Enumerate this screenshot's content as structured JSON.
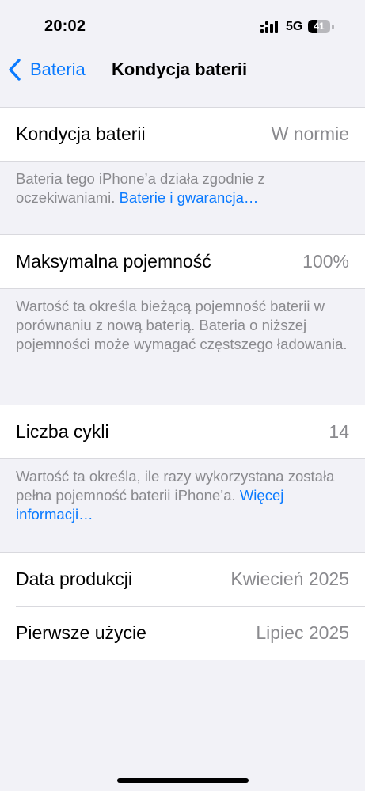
{
  "status_bar": {
    "time": "20:02",
    "network": "5G",
    "battery_level": "41",
    "battery_fraction": 0.41,
    "icons": [
      "signal-icon",
      "battery-icon"
    ]
  },
  "nav": {
    "back_label": "Bateria",
    "title": "Kondycja baterii",
    "back_icon": "chevron-left-icon"
  },
  "colors": {
    "accent": "#0a7aff",
    "background": "#f2f2f7",
    "secondary_text": "#8a8a8e"
  },
  "health": {
    "label": "Kondycja baterii",
    "value": "W normie",
    "footer_text": "Bateria tego iPhone’a działa zgodnie z oczekiwaniami.",
    "footer_link": "Baterie i gwarancja…"
  },
  "capacity": {
    "label": "Maksymalna pojemność",
    "value": "100%",
    "footer_text": "Wartość ta określa bieżącą pojemność baterii w porównaniu z nową baterią. Bateria o niższej pojemności może wymagać częstszego ładowania."
  },
  "cycles": {
    "label": "Liczba cykli",
    "value": "14",
    "footer_text": "Wartość ta określa, ile razy wykorzystana została pełna pojemność baterii iPhone’a.",
    "footer_link": "Więcej informacji…"
  },
  "dates": [
    {
      "label": "Data produkcji",
      "value": "Kwiecień 2025"
    },
    {
      "label": "Pierwsze użycie",
      "value": "Lipiec 2025"
    }
  ]
}
